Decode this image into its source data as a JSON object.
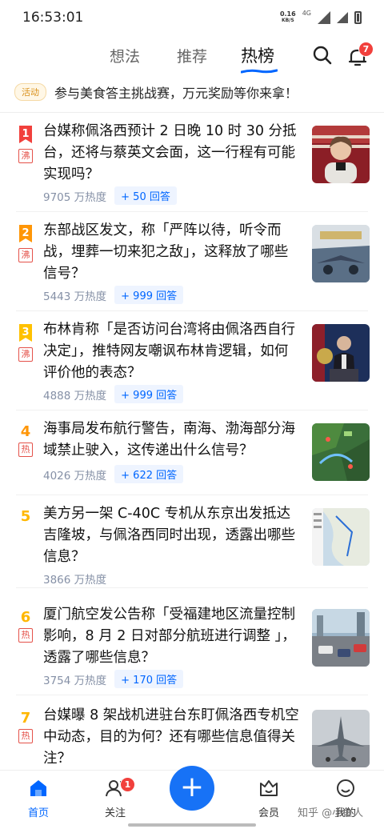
{
  "status": {
    "time": "16:53:01",
    "net_speed": "0.16",
    "net_unit": "KB/S",
    "network": "4G"
  },
  "nav": {
    "tabs": [
      {
        "label": "想法"
      },
      {
        "label": "推荐"
      },
      {
        "label": "热榜"
      }
    ],
    "active_tab": "热榜",
    "notification_count": "7"
  },
  "promo": {
    "tag": "活动",
    "text": "参与美食答主挑战赛，万元奖励等你来拿！"
  },
  "hot_list": [
    {
      "rank": "1",
      "tag": "沸",
      "title": "台媒称佩洛西预计 2 日晚 10 时 30 分抵台，还将与蔡英文会面，这一行程有可能实现吗？",
      "heat": "9705 万热度",
      "answers": "+ 50 回答"
    },
    {
      "rank": "2",
      "tag": "沸",
      "title": "东部战区发文，称「严阵以待，听令而战，埋葬一切来犯之敌」，这释放了哪些信号？",
      "heat": "5443 万热度",
      "answers": "+ 999 回答"
    },
    {
      "rank": "3",
      "tag": "沸",
      "title": "布林肯称「是否访问台湾将由佩洛西自行决定」，推特网友嘲讽布林肯逻辑，如何评价他的表态？",
      "heat": "4888 万热度",
      "answers": "+ 999 回答"
    },
    {
      "rank": "4",
      "tag": "热",
      "title": "海事局发布航行警告，南海、渤海部分海域禁止驶入，这传递出什么信号？",
      "heat": "4026 万热度",
      "answers": "+ 622 回答"
    },
    {
      "rank": "5",
      "tag": "",
      "title": "美方另一架 C-40C 专机从东京出发抵达吉隆坡，与佩洛西同时出现，透露出哪些信息？",
      "heat": "3866 万热度",
      "answers": ""
    },
    {
      "rank": "6",
      "tag": "热",
      "title": "厦门航空发公告称「受福建地区流量控制影响，8 月 2 日对部分航班进行调整 」，透露了哪些信息？",
      "heat": "3754 万热度",
      "answers": "+ 170 回答"
    },
    {
      "rank": "7",
      "tag": "热",
      "title": "台媒曝 8 架战机进驻台东盯佩洛西专机空中动态，目的为何？还有哪些信息值得关注？",
      "heat": "",
      "answers": ""
    }
  ],
  "bottom_nav": {
    "home": "首页",
    "follow": "关注",
    "follow_badge": "1",
    "add": "+",
    "vip": "会员",
    "me": "我的"
  },
  "watermark": "知乎 @小鱼人",
  "colors": {
    "accent": "#0066ff",
    "rank_top": "#f1403c",
    "rank_2": "#ff9607",
    "rank_3": "#ffc100"
  }
}
